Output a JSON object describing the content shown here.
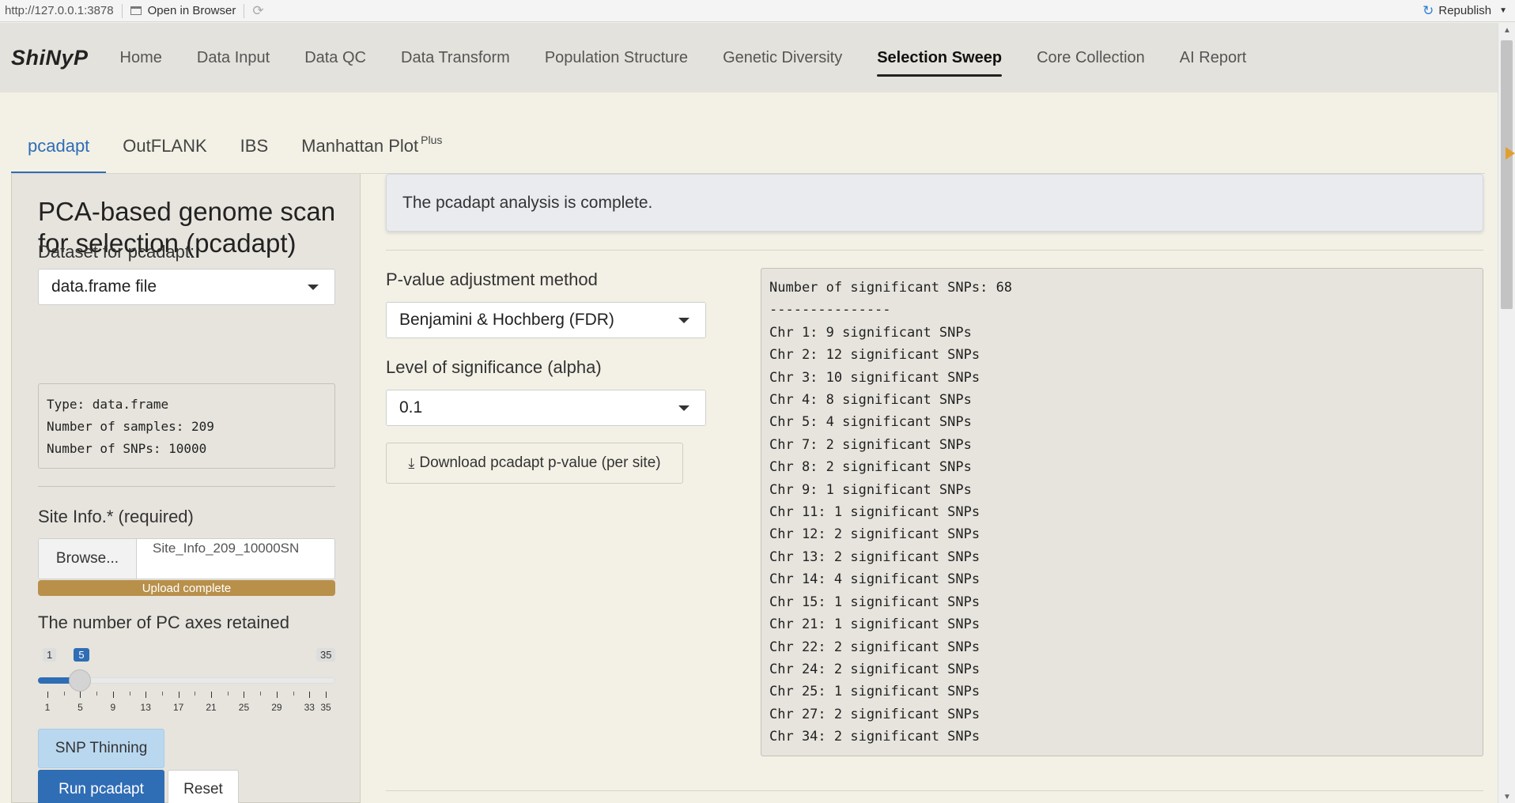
{
  "browser": {
    "url": "http://127.0.0.1:3878",
    "open_in_browser": "Open in Browser",
    "republish": "Republish"
  },
  "nav": {
    "brand": "ShiNyP",
    "items": [
      {
        "label": "Home"
      },
      {
        "label": "Data Input"
      },
      {
        "label": "Data QC"
      },
      {
        "label": "Data Transform"
      },
      {
        "label": "Population Structure"
      },
      {
        "label": "Genetic Diversity"
      },
      {
        "label": "Selection Sweep"
      },
      {
        "label": "Core Collection"
      },
      {
        "label": "AI Report"
      }
    ],
    "active": "Selection Sweep"
  },
  "subtabs": {
    "items": [
      {
        "label": "pcadapt"
      },
      {
        "label": "OutFLANK"
      },
      {
        "label": "IBS"
      },
      {
        "label": "Manhattan Plot",
        "sup": "Plus"
      }
    ],
    "active": "pcadapt"
  },
  "sidebar": {
    "title": "PCA-based genome scan for selection (pcadapt)",
    "dataset_label": "Dataset for pcadapt:",
    "dataset_value": "data.frame file",
    "info": {
      "line1": "Type: data.frame",
      "line2": "Number of samples: 209",
      "line3": "Number of SNPs: 10000"
    },
    "site_info_label": "Site Info.* (required)",
    "browse_label": "Browse...",
    "file_name": "Site_Info_209_10000SN",
    "upload_status": "Upload complete",
    "upload_progress": 1.0,
    "pc_label": "The number of PC axes retained",
    "slider": {
      "min": 1,
      "max": 35,
      "value": 5,
      "min_label": "1",
      "max_label": "35",
      "value_label": "5",
      "tick_labels": [
        "1",
        "5",
        "9",
        "13",
        "17",
        "21",
        "25",
        "29",
        "33",
        "35"
      ]
    },
    "thinning_label": "SNP Thinning",
    "run_label": "Run pcadapt",
    "reset_label": "Reset"
  },
  "main": {
    "alert": "The pcadapt analysis is complete.",
    "pvalue_label": "P-value adjustment method",
    "pvalue_value": "Benjamini & Hochberg (FDR)",
    "alpha_label": "Level of significance (alpha)",
    "alpha_value": "0.1",
    "download_label": "Download pcadapt p-value (per site)",
    "output_lines": [
      "Number of significant SNPs: 68",
      "---------------",
      "Chr 1: 9 significant SNPs",
      "Chr 2: 12 significant SNPs",
      "Chr 3: 10 significant SNPs",
      "Chr 4: 8 significant SNPs",
      "Chr 5: 4 significant SNPs",
      "Chr 7: 2 significant SNPs",
      "Chr 8: 2 significant SNPs",
      "Chr 9: 1 significant SNPs",
      "Chr 11: 1 significant SNPs",
      "Chr 12: 2 significant SNPs",
      "Chr 13: 2 significant SNPs",
      "Chr 14: 4 significant SNPs",
      "Chr 15: 1 significant SNPs",
      "Chr 21: 1 significant SNPs",
      "Chr 22: 2 significant SNPs",
      "Chr 24: 2 significant SNPs",
      "Chr 25: 1 significant SNPs",
      "Chr 27: 2 significant SNPs",
      "Chr 34: 2 significant SNPs"
    ]
  },
  "colors": {
    "accent": "#2f6db5",
    "progress": "#b8904a",
    "navbar": "#e4e2dc",
    "page": "#f3f1e6"
  }
}
